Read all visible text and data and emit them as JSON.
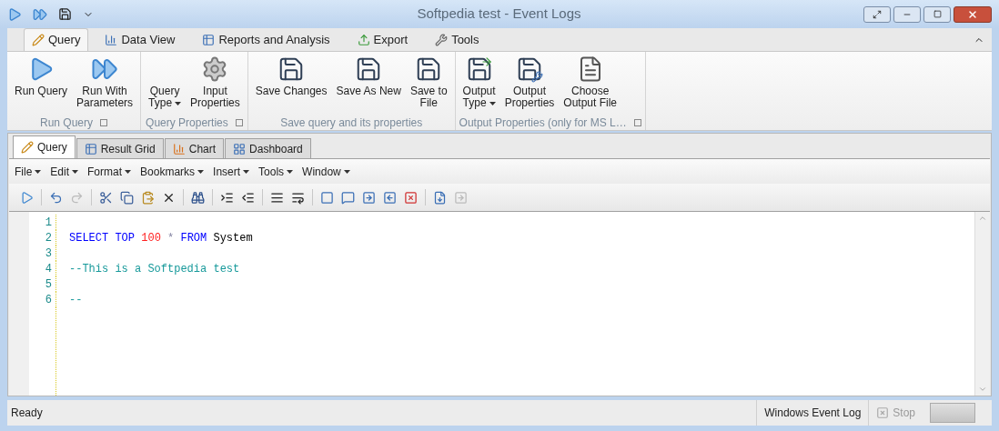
{
  "window": {
    "title": "Softpedia test - Event Logs"
  },
  "ribbon_tabs": [
    {
      "label": "Query",
      "selected": true
    },
    {
      "label": "Data View",
      "selected": false
    },
    {
      "label": "Reports and Analysis",
      "selected": false
    },
    {
      "label": "Export",
      "selected": false
    },
    {
      "label": "Tools",
      "selected": false
    }
  ],
  "ribbon_groups": [
    {
      "label": "Run Query",
      "launcher": true,
      "buttons": [
        {
          "label": "Run Query",
          "dropdown": false
        },
        {
          "label": "Run With\nParameters",
          "dropdown": false
        }
      ]
    },
    {
      "label": "Query Properties",
      "launcher": true,
      "buttons": [
        {
          "label": "Query\nType",
          "dropdown": true
        },
        {
          "label": "Input\nProperties",
          "dropdown": false
        }
      ]
    },
    {
      "label": "Save query and its properties",
      "launcher": false,
      "buttons": [
        {
          "label": "Save Changes",
          "dropdown": false
        },
        {
          "label": "Save As New",
          "dropdown": false
        },
        {
          "label": "Save to\nFile",
          "dropdown": false
        }
      ]
    },
    {
      "label": "Output Properties (only for MS L…",
      "launcher": true,
      "buttons": [
        {
          "label": "Output\nType",
          "dropdown": true
        },
        {
          "label": "Output\nProperties",
          "dropdown": false
        },
        {
          "label": "Choose\nOutput File",
          "dropdown": false
        }
      ]
    }
  ],
  "doc_tabs": [
    {
      "label": "Query",
      "selected": true
    },
    {
      "label": "Result Grid",
      "selected": false
    },
    {
      "label": "Chart",
      "selected": false
    },
    {
      "label": "Dashboard",
      "selected": false
    }
  ],
  "menu": [
    "File",
    "Edit",
    "Format",
    "Bookmarks",
    "Insert",
    "Tools",
    "Window"
  ],
  "editor": {
    "lines": [
      {
        "number": "1"
      },
      {
        "number": "2",
        "tokens": [
          {
            "kind": "keyword",
            "text": "SELECT"
          },
          {
            "kind": "keyword",
            "text": "TOP"
          },
          {
            "kind": "number",
            "text": "100"
          },
          {
            "kind": "operator",
            "text": "*"
          },
          {
            "kind": "keyword",
            "text": "FROM"
          },
          {
            "kind": "identifier",
            "text": "System"
          }
        ]
      },
      {
        "number": "3"
      },
      {
        "number": "4",
        "tokens": [
          {
            "kind": "comment",
            "text": "--This is a Softpedia test"
          }
        ]
      },
      {
        "number": "5"
      },
      {
        "number": "6",
        "tokens": [
          {
            "kind": "comment",
            "text": "--"
          }
        ]
      }
    ]
  },
  "status_bar": {
    "status": "Ready",
    "source": "Windows Event Log",
    "stop": {
      "label": "Stop",
      "disabled": true
    }
  }
}
